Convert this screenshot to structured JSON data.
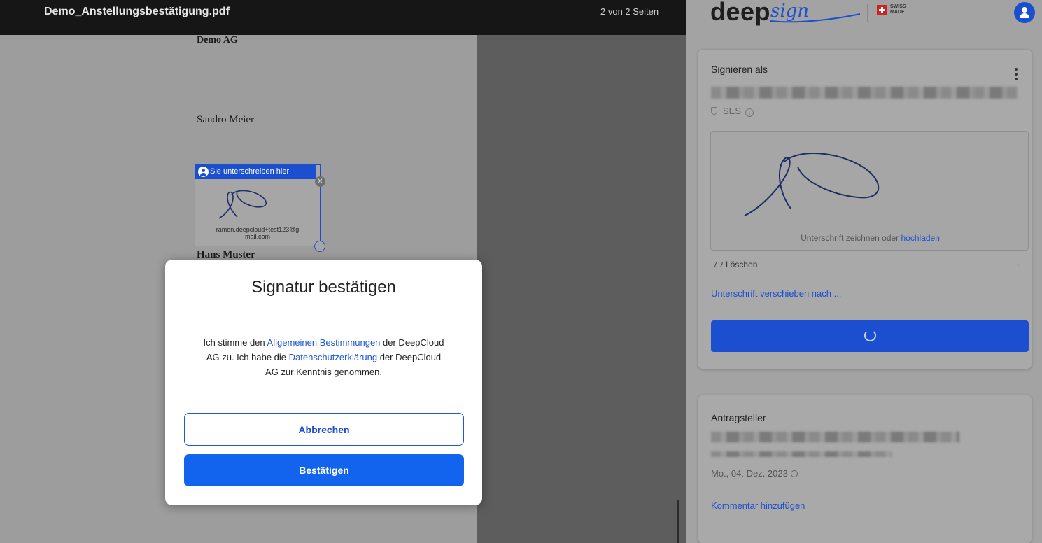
{
  "viewer": {
    "file_title": "Demo_Anstellungsbestätigung.pdf",
    "page_count": "2 von 2 Seiten"
  },
  "document": {
    "company": "Demo AG",
    "signer_1": "Sandro Meier",
    "signer_2": "Hans Muster",
    "sig_field": {
      "header": "Sie unterschreiben hier",
      "email_line1": "ramon.deepcloud+test123@g",
      "email_line2": "mail.com"
    }
  },
  "modal": {
    "title": "Signatur bestätigen",
    "body_1": "Ich stimme den ",
    "link_terms": "Allgemeinen Bestimmungen",
    "body_2": " der DeepCloud AG zu. Ich habe die ",
    "link_privacy": "Datenschutzerklärung",
    "body_3": " der DeepCloud AG zur Kenntnis genommen.",
    "cancel_label": "Abbrechen",
    "confirm_label": "Bestätigen"
  },
  "panel": {
    "brand": "deep",
    "brand_script": "sign",
    "swiss_label": "SWISS MADE",
    "sign_card": {
      "label": "Signieren als",
      "level": "SES",
      "pad_hint": "Unterschrift zeichnen oder ",
      "pad_link": "hochladen",
      "clear_label": "Löschen",
      "clear_dots": "⋮",
      "move_link": "Unterschrift verschieben nach ..."
    },
    "requester_card": {
      "label": "Antragsteller",
      "date": "Mo., 04. Dez. 2023",
      "comment_link": "Kommentar hinzufügen"
    }
  },
  "colors": {
    "accent": "#1b4fd0",
    "confirm_button": "#1264ef",
    "topbar": "#161616"
  }
}
